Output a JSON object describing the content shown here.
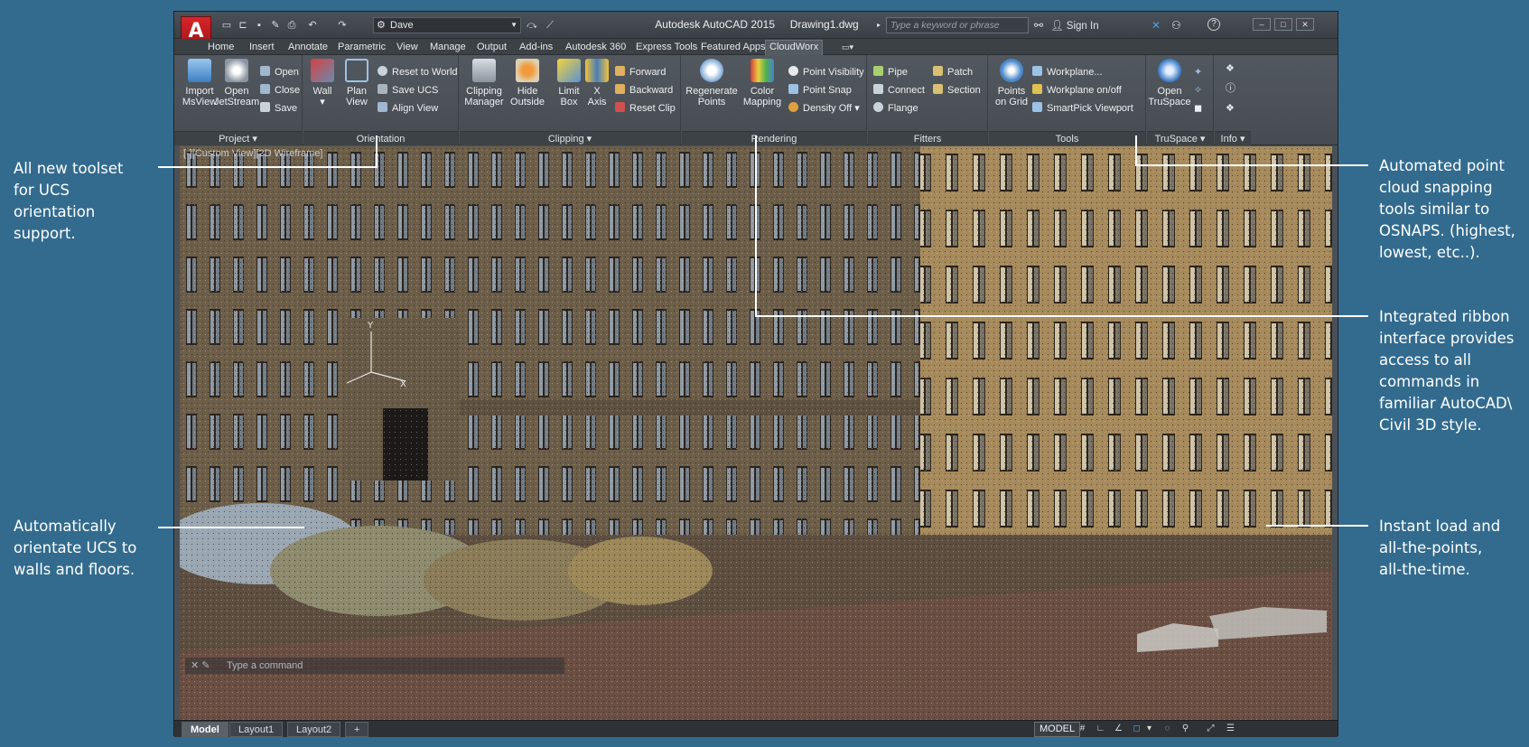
{
  "callouts": {
    "ucs_toolset": "All new toolset\nfor UCS\norientation\nsupport.",
    "ucs_walls": "Automatically\norientate UCS to\nwalls and floors.",
    "snapping": "Automated point\ncloud snapping\ntools similar to\nOSNAPS. (highest,\nlowest, etc..).",
    "ribbon": "Integrated ribbon\ninterface provides\naccess to all\ncommands in\nfamiliar AutoCAD\\\nCivil 3D style.",
    "instant_load": "Instant load and\nall-the-points,\nall-the-time."
  },
  "window": {
    "title": "Autodesk AutoCAD 2015     Drawing1.dwg",
    "app_button": "A",
    "workspace": "Dave",
    "search_placeholder": "Type a keyword or phrase",
    "sign_in": "Sign In",
    "help": "?"
  },
  "tabs": [
    "Home",
    "Insert",
    "Annotate",
    "Parametric",
    "View",
    "Manage",
    "Output",
    "Add-ins",
    "Autodesk 360",
    "Express Tools",
    "Featured Apps",
    "CloudWorx"
  ],
  "active_tab": "CloudWorx",
  "ribbon": {
    "project": {
      "title": "Project",
      "import": "Import\nMsView",
      "open_js": "Open\nJetStream",
      "open": "Open",
      "close": "Close",
      "save": "Save"
    },
    "orientation": {
      "title": "Orientation",
      "wall": "Wall",
      "plan_view": "Plan\nView",
      "reset_world": "Reset to World",
      "save_ucs": "Save UCS",
      "align_view": "Align View"
    },
    "clipping": {
      "title": "Clipping",
      "manager": "Clipping\nManager",
      "hide_outside": "Hide\nOutside",
      "limit_box": "Limit\nBox",
      "x_axis": "X\nAxis",
      "forward": "Forward",
      "backward": "Backward",
      "reset_clip": "Reset Clip"
    },
    "rendering": {
      "title": "Rendering",
      "regenerate": "Regenerate\nPoints",
      "color_mapping": "Color\nMapping",
      "point_visibility": "Point Visibility",
      "point_snap": "Point Snap",
      "density_off": "Density Off"
    },
    "fitters": {
      "title": "Fitters",
      "pipe": "Pipe",
      "connect": "Connect",
      "flange": "Flange",
      "patch": "Patch",
      "section": "Section"
    },
    "tools": {
      "title": "Tools",
      "points_on_grid": "Points\non Grid",
      "workplane": "Workplane...",
      "workplane_onoff": "Workplane on/off",
      "smartpick": "SmartPick Viewport"
    },
    "truspace": {
      "title": "TruSpace",
      "open": "Open\nTruSpace"
    },
    "info": {
      "title": "Info"
    }
  },
  "viewport_label": "[-][Custom View][2D Wireframe]",
  "command_line": "Type a command",
  "layout_tabs": [
    "Model",
    "Layout1",
    "Layout2"
  ],
  "status": {
    "model": "MODEL"
  },
  "colors": {
    "background": "#336b8e",
    "app_red": "#c81e24",
    "window": "#4a5056"
  }
}
